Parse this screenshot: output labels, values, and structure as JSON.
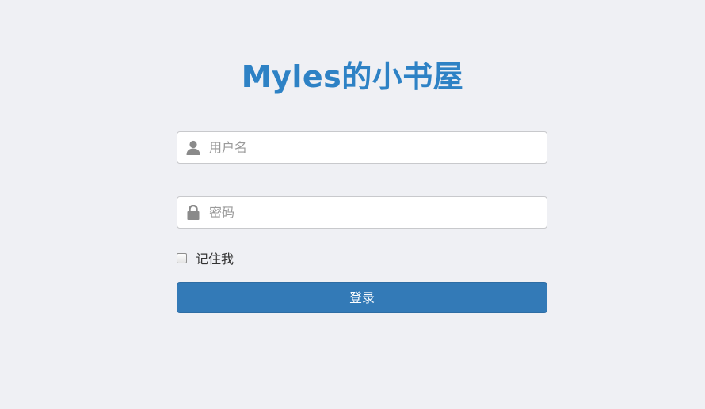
{
  "title": "Myles的小书屋",
  "username": {
    "placeholder": "用户名",
    "value": "",
    "icon": "user-icon"
  },
  "password": {
    "placeholder": "密码",
    "value": "",
    "icon": "lock-icon"
  },
  "remember": {
    "label": "记住我",
    "checked": false
  },
  "login_button": {
    "label": "登录"
  },
  "colors": {
    "background": "#eff0f4",
    "title": "#2e82c5",
    "button": "#337ab7",
    "icon": "#8a8a8a"
  }
}
